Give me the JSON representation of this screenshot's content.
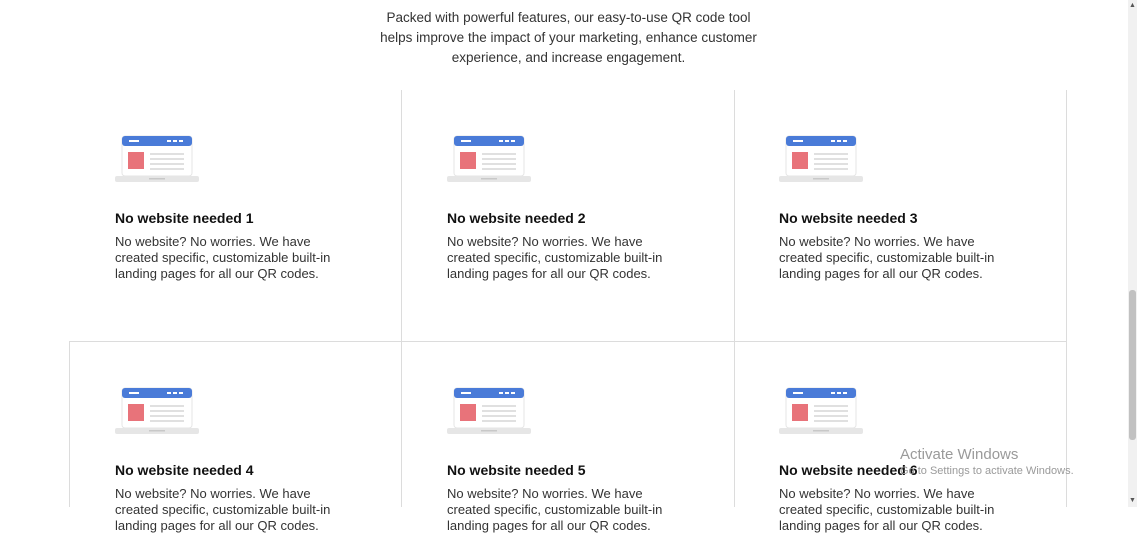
{
  "intro": {
    "line1": "Packed with powerful features, our easy-to-use QR code tool",
    "line2": "helps improve the impact of your marketing, enhance customer",
    "line3": "experience, and increase engagement."
  },
  "cards": [
    {
      "title": "No website needed 1",
      "desc_line1": "No website? No worries. We have",
      "desc_line2": "created specific, customizable built-in",
      "desc_line3": "landing pages for all our QR codes."
    },
    {
      "title": "No website needed 2",
      "desc_line1": "No website? No worries. We have",
      "desc_line2": "created specific, customizable built-in",
      "desc_line3": "landing pages for all our QR codes."
    },
    {
      "title": "No website needed 3",
      "desc_line1": "No website? No worries. We have",
      "desc_line2": "created specific, customizable built-in",
      "desc_line3": "landing pages for all our QR codes."
    },
    {
      "title": "No website needed 4",
      "desc_line1": "No website? No worries. We have",
      "desc_line2": "created specific, customizable built-in",
      "desc_line3": "landing pages for all our QR codes."
    },
    {
      "title": "No website needed 5",
      "desc_line1": "No website? No worries. We have",
      "desc_line2": "created specific, customizable built-in",
      "desc_line3": "landing pages for all our QR codes."
    },
    {
      "title": "No website needed 6",
      "desc_line1": "No website? No worries. We have",
      "desc_line2": "created specific, customizable built-in",
      "desc_line3": "landing pages for all our QR codes."
    }
  ],
  "card_icon": "laptop-landing-page-icon",
  "colors": {
    "accent_blue": "#4a7bd8",
    "accent_red": "#e8737a",
    "grid": "#dcdcdc"
  },
  "watermark": {
    "title": "Activate Windows",
    "subtitle": "Go to Settings to activate Windows."
  }
}
